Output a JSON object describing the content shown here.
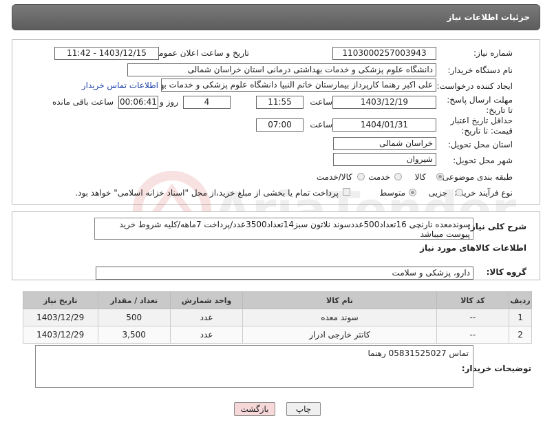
{
  "panel_title": "جزئیات اطلاعات نیاز",
  "fields": {
    "need_number_label": "شماره نیاز:",
    "need_number": "1103000257003943",
    "announce_label": "تاریخ و ساعت اعلان عمومی:",
    "announce_value": "1403/12/15 - 11:42",
    "buyer_org_label": "نام دستگاه خریدار:",
    "buyer_org": "دانشگاه علوم پزشکی و خدمات بهداشتی درمانی استان خراسان شمالی",
    "creator_label": "ایجاد کننده درخواست:",
    "creator": "علی اکبر رهنما کارپرداز بیمارستان خاتم النبیا دانشگاه علوم پزشکی و خدمات بهداشتی",
    "contact_link": "اطلاعات تماس خریدار",
    "deadline_label": "مهلت ارسال پاسخ: تا تاریخ:",
    "deadline_date": "1403/12/19",
    "time_label": "ساعت",
    "deadline_time": "11:55",
    "days": "4",
    "days_label": "روز و",
    "remaining": "00:06:41",
    "remaining_label": "ساعت باقی مانده",
    "validity_label": "حداقل تاریخ اعتبار قیمت: تا تاریخ:",
    "validity_date": "1404/01/31",
    "validity_time": "07:00",
    "province_label": "استان محل تحویل:",
    "province": "خراسان شمالی",
    "city_label": "شهر محل تحویل:",
    "city": "شیروان",
    "category_label": "طبقه بندی موضوعی:",
    "category_options": [
      "کالا",
      "خدمت",
      "کالا/خدمت"
    ],
    "process_label": "نوع فرآیند خرید :",
    "process_options": [
      "جزیی",
      "متوسط"
    ],
    "payment_note": "پرداخت تمام یا بخشی از مبلغ خرید،از محل \"اسناد خزانه اسلامی\" خواهد بود."
  },
  "summary": {
    "label": "شرح کلی نیاز:",
    "text": "سوندمعده نارنچی 16تعداد500عددسوند نلاتون سبز14تعداد3500عدد/پرداخت 7ماهه/کلیه شروط خرید پیوست میباشد"
  },
  "goods_section_title": "اطلاعات کالاهای مورد نیاز",
  "goods_group_label": "گروه کالا:",
  "goods_group": "دارو، پزشکی و سلامت",
  "table": {
    "headers": [
      "ردیف",
      "کد کالا",
      "نام کالا",
      "واحد شمارش",
      "تعداد / مقدار",
      "تاریخ نیاز"
    ],
    "rows": [
      [
        "1",
        "--",
        "سوند معده",
        "عدد",
        "500",
        "1403/12/29"
      ],
      [
        "2",
        "--",
        "کاتتر خارجی ادرار",
        "عدد",
        "3,500",
        "1403/12/29"
      ]
    ]
  },
  "buyer_notes_label": "توضیحات خریدار:",
  "buyer_notes": "تماس 05831525027 رهنما",
  "buttons": {
    "print": "چاپ",
    "back": "بازگشت"
  },
  "watermark": "AriaTender.net"
}
